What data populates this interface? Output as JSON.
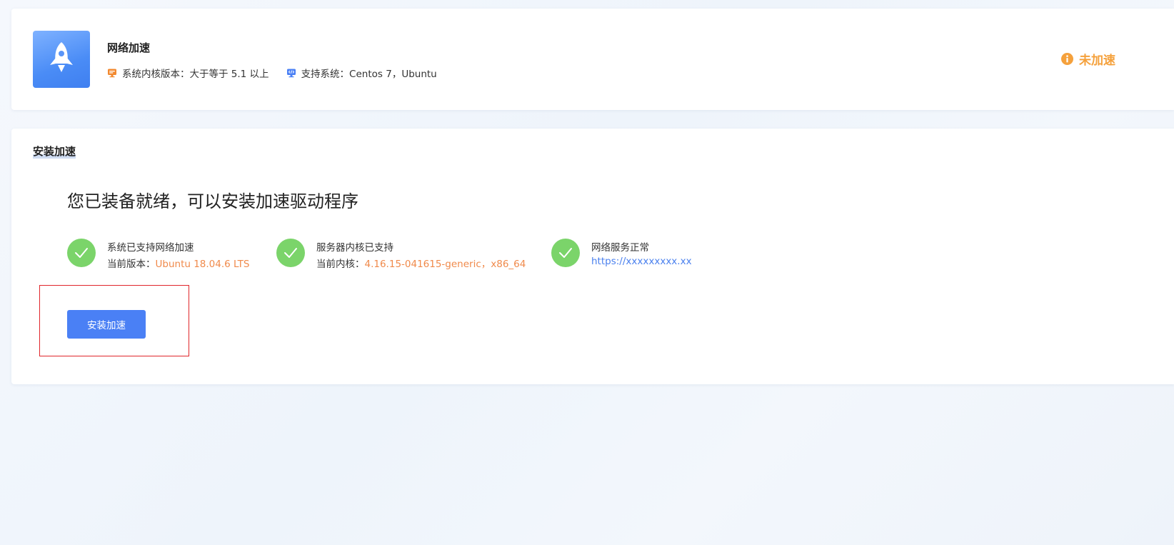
{
  "app": {
    "title": "网络加速",
    "logo_icon": "rocket-icon",
    "kernel_label": "系统内核版本：大于等于 5.1 以上",
    "kernel_icon": "server-icon",
    "systems_label": "支持系统：Centos 7，Ubuntu",
    "systems_icon": "monitor-code-icon",
    "status": "未加速",
    "status_icon": "info-icon",
    "status_color": "#f5a13c"
  },
  "install": {
    "section_title": "安装加速",
    "ready_title": "您已装备就绪，可以安装加速驱动程序",
    "checks": [
      {
        "icon": "check-circle-icon",
        "title": "系统已支持网络加速",
        "detail_label": "当前版本：",
        "detail_value": "Ubuntu 18.04.6 LTS"
      },
      {
        "icon": "check-circle-icon",
        "title": "服务器内核已支持",
        "detail_label": "当前内核：",
        "detail_value": "4.16.15-041615-generic，x86_64"
      },
      {
        "icon": "check-circle-icon",
        "title": "网络服务正常",
        "detail_label": "",
        "detail_value": "https://xxxxxxxxx.xx"
      }
    ],
    "button_label": "安装加速"
  },
  "colors": {
    "accent": "#4a80f5",
    "check_green": "#7bd46a",
    "value_orange": "#f08a4b",
    "link_blue": "#4a80ee",
    "highlight_red": "#e0262b"
  }
}
